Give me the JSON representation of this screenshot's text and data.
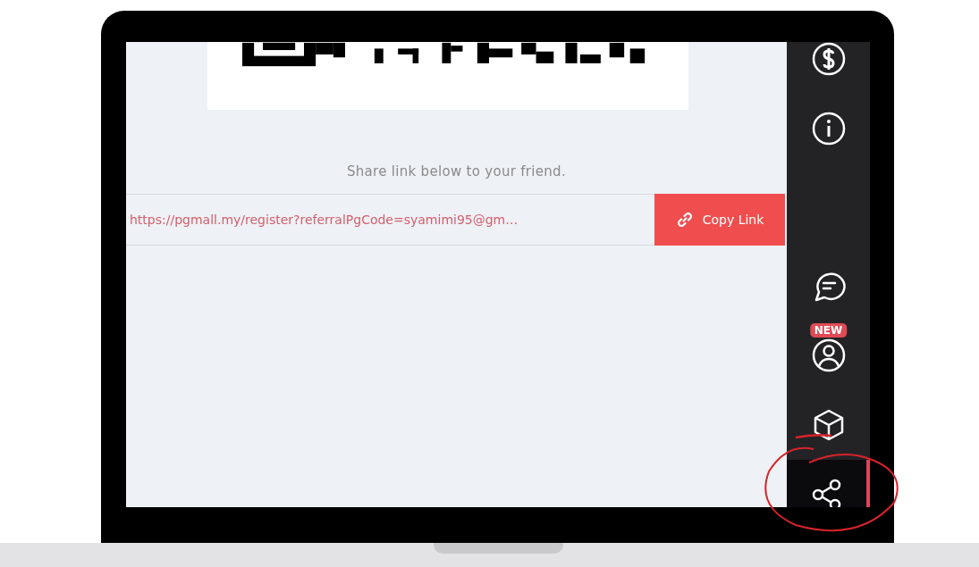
{
  "share_panel": {
    "instruction": "Share link below to your friend.",
    "link_field": {
      "value": "https://pgmall.my/register?referralPgCode=syamimi95@gm…"
    },
    "copy_button": {
      "label": "Copy Link"
    }
  },
  "sidebar": {
    "items": [
      {
        "kind": "dollar",
        "selected": false
      },
      {
        "kind": "info",
        "selected": false
      },
      {
        "kind": "chat",
        "selected": false
      },
      {
        "kind": "user",
        "selected": false,
        "badge": "NEW"
      },
      {
        "kind": "box",
        "selected": false
      },
      {
        "kind": "share",
        "selected": true
      }
    ]
  }
}
